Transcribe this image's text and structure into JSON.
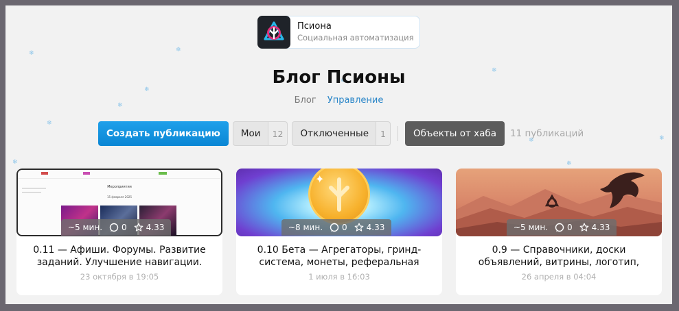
{
  "brand": {
    "name": "Псиона",
    "subtitle": "Социальная автоматизация"
  },
  "page": {
    "title": "Блог Псионы"
  },
  "subnav": {
    "blog": "Блог",
    "manage": "Управление"
  },
  "toolbar": {
    "create_label": "Создать публикацию",
    "mine_label": "Мои",
    "mine_count": "12",
    "disabled_label": "Отключенные",
    "disabled_count": "1",
    "hub_label": "Объекты от хаба",
    "publications_count": "11 публикаций"
  },
  "mini_preview": {
    "heading": "Мероприятия",
    "date": "15 февраля 2025"
  },
  "cards": [
    {
      "read_time": "~5 мин.",
      "comments": "0",
      "rating": "4.33",
      "title": "0.11 — Афиши. Форумы. Развитие заданий. Улучшение навигации.",
      "date": "23 октября в 19:05"
    },
    {
      "read_time": "~8 мин.",
      "comments": "0",
      "rating": "4.33",
      "title": "0.10 Бета — Агрегаторы, гринд-система, монеты, реферальная",
      "date": "1 июля в 16:03"
    },
    {
      "read_time": "~5 мин.",
      "comments": "0",
      "rating": "4.33",
      "title": "0.9 — Справочники, доски объявлений, витрины, логотип,",
      "date": "26 апреля в 04:04"
    }
  ],
  "colors": {
    "primary": "#0a86d4",
    "link": "#2a86c8",
    "dark_button": "#5c5c5c",
    "background": "#f2f2f2"
  }
}
